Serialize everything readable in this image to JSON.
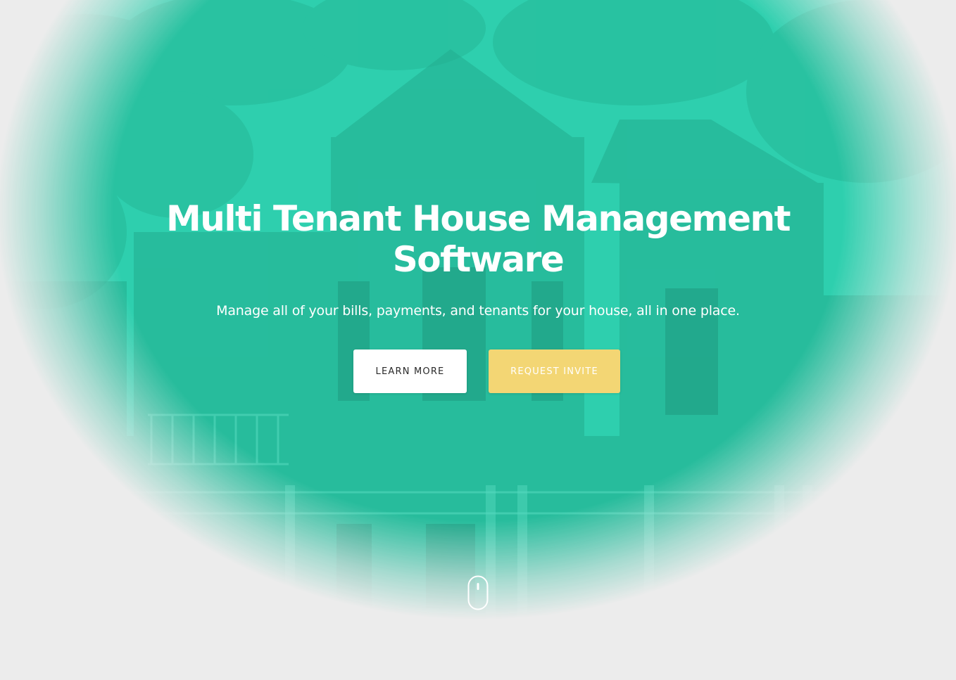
{
  "hero": {
    "title_line1": "Multi Tenant House Management",
    "title_line2": "Software",
    "subtitle": "Manage all of your bills, payments, and tenants for your house, all in one place.",
    "primary_button_label": "LEARN MORE",
    "secondary_button_label": "REQUEST INVITE",
    "scroll_icon": "mouse-scroll-icon"
  },
  "colors": {
    "teal_overlay": "#2ecfae",
    "button_white": "#ffffff",
    "button_yellow": "#f3d674",
    "page_background": "#ececec"
  }
}
